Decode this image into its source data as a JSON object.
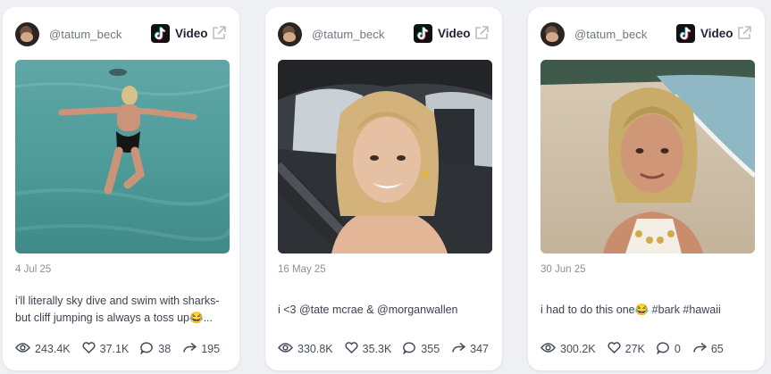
{
  "cards": [
    {
      "handle": "@tatum_beck",
      "platform_label": "Video",
      "date": "4 Jul 25",
      "caption": "i’ll literally sky dive and swim with sharks- but cliff jumping is always a toss up😂...",
      "stats": {
        "views": "243.4K",
        "likes": "37.1K",
        "comments": "38",
        "shares": "195"
      }
    },
    {
      "handle": "@tatum_beck",
      "platform_label": "Video",
      "date": "16 May 25",
      "caption": "i <3 @tate mcrae & @morganwallen",
      "stats": {
        "views": "330.8K",
        "likes": "35.3K",
        "comments": "355",
        "shares": "347"
      }
    },
    {
      "handle": "@tatum_beck",
      "platform_label": "Video",
      "date": "30 Jun 25",
      "caption": "i had to do this one😂 #bark #hawaii",
      "stats": {
        "views": "300.2K",
        "likes": "27K",
        "comments": "0",
        "shares": "65"
      }
    }
  ],
  "icons": {
    "platform": "tiktok-icon",
    "external": "external-link-icon",
    "views": "eye-icon",
    "likes": "heart-icon",
    "comments": "comment-icon",
    "shares": "share-icon"
  },
  "colors": {
    "background": "#eef0f3",
    "card": "#ffffff",
    "text_muted": "#8a9099"
  }
}
